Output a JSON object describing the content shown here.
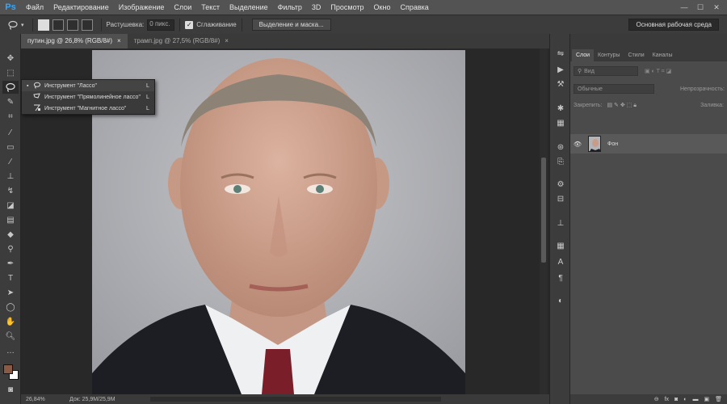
{
  "app": {
    "logo": "Ps"
  },
  "menu": [
    "Файл",
    "Редактирование",
    "Изображение",
    "Слои",
    "Текст",
    "Выделение",
    "Фильтр",
    "3D",
    "Просмотр",
    "Окно",
    "Справка"
  ],
  "options": {
    "feather_label": "Растушевка:",
    "feather_value": "0 пикс.",
    "antialias_label": "Сглаживание",
    "select_mask_label": "Выделение и маска...",
    "workspace": "Основная рабочая среда"
  },
  "tabs": [
    {
      "title": "путин.jpg @ 26,8% (RGB/8#)",
      "close": "×"
    },
    {
      "title": "трамп.jpg @ 27,5% (RGB/8#)",
      "close": "×"
    }
  ],
  "flyout": [
    {
      "label": "Инструмент \"Лассо\"",
      "key": "L"
    },
    {
      "label": "Инструмент \"Прямолинейное лассо\"",
      "key": "L"
    },
    {
      "label": "Инструмент \"Магнитное лассо\"",
      "key": "L"
    }
  ],
  "panel": {
    "tabs": [
      "Слои",
      "Контуры",
      "Стили",
      "Каналы"
    ],
    "kind_placeholder": "Вид",
    "blend_mode": "Обычные",
    "opacity_label": "Непрозрачность:",
    "lock_label": "Закрепить:",
    "fill_label": "Заливка:",
    "layer_name": "Фон"
  },
  "status": {
    "zoom": "26,84%",
    "doc": "Док: 25,9M/25,9M"
  },
  "colors": {
    "foreground": "#8a5a44",
    "background": "#ffffff",
    "accent": "#31a8ff"
  }
}
